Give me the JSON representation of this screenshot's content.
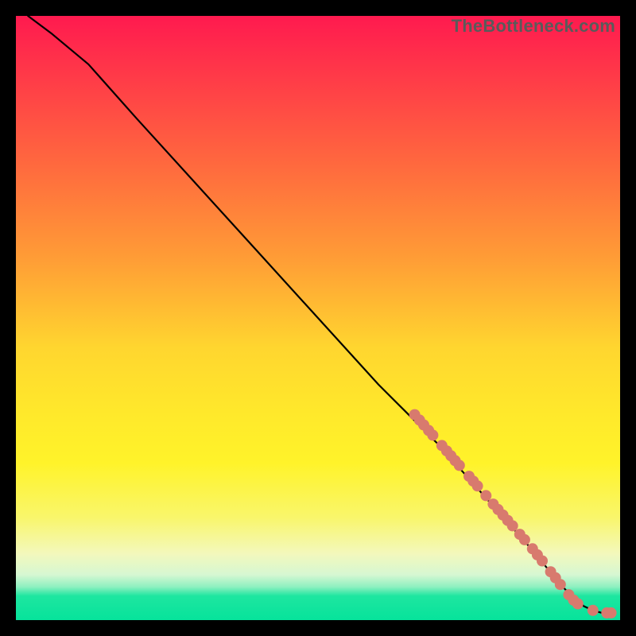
{
  "watermark": "TheBottleneck.com",
  "colors": {
    "dot": "#d87a6e",
    "line": "#000000",
    "frame": "#000000"
  },
  "chart_data": {
    "type": "line",
    "title": "",
    "xlabel": "",
    "ylabel": "",
    "xlim": [
      0,
      100
    ],
    "ylim": [
      0,
      100
    ],
    "grid": false,
    "legend": false,
    "series": [
      {
        "name": "curve",
        "kind": "line",
        "x": [
          2,
          6,
          12,
          20,
          30,
          40,
          50,
          60,
          66,
          70,
          74,
          78,
          82,
          86,
          88,
          90,
          92,
          94,
          95.5,
          97,
          98.5
        ],
        "y": [
          100,
          97,
          92,
          83,
          72,
          61,
          50,
          39,
          33,
          29,
          24.5,
          20,
          15.5,
          11,
          8.5,
          6,
          4,
          2.3,
          1.6,
          1.2,
          1.2
        ]
      },
      {
        "name": "markers",
        "kind": "scatter",
        "points": [
          {
            "x": 66.0,
            "y": 34.0
          },
          {
            "x": 66.8,
            "y": 33.1
          },
          {
            "x": 67.5,
            "y": 32.3
          },
          {
            "x": 68.3,
            "y": 31.4
          },
          {
            "x": 69.0,
            "y": 30.6
          },
          {
            "x": 70.5,
            "y": 28.9
          },
          {
            "x": 71.3,
            "y": 28.0
          },
          {
            "x": 72.0,
            "y": 27.2
          },
          {
            "x": 72.7,
            "y": 26.4
          },
          {
            "x": 73.4,
            "y": 25.6
          },
          {
            "x": 75.0,
            "y": 23.8
          },
          {
            "x": 75.7,
            "y": 23.0
          },
          {
            "x": 76.4,
            "y": 22.2
          },
          {
            "x": 77.8,
            "y": 20.6
          },
          {
            "x": 79.0,
            "y": 19.2
          },
          {
            "x": 79.8,
            "y": 18.3
          },
          {
            "x": 80.6,
            "y": 17.4
          },
          {
            "x": 81.4,
            "y": 16.5
          },
          {
            "x": 82.2,
            "y": 15.6
          },
          {
            "x": 83.4,
            "y": 14.2
          },
          {
            "x": 84.2,
            "y": 13.3
          },
          {
            "x": 85.5,
            "y": 11.8
          },
          {
            "x": 86.3,
            "y": 10.8
          },
          {
            "x": 87.1,
            "y": 9.8
          },
          {
            "x": 88.5,
            "y": 8.0
          },
          {
            "x": 89.3,
            "y": 7.0
          },
          {
            "x": 90.1,
            "y": 5.9
          },
          {
            "x": 91.5,
            "y": 4.2
          },
          {
            "x": 92.3,
            "y": 3.3
          },
          {
            "x": 93.0,
            "y": 2.7
          },
          {
            "x": 95.5,
            "y": 1.6
          },
          {
            "x": 97.8,
            "y": 1.2
          },
          {
            "x": 98.5,
            "y": 1.2
          }
        ]
      }
    ]
  }
}
